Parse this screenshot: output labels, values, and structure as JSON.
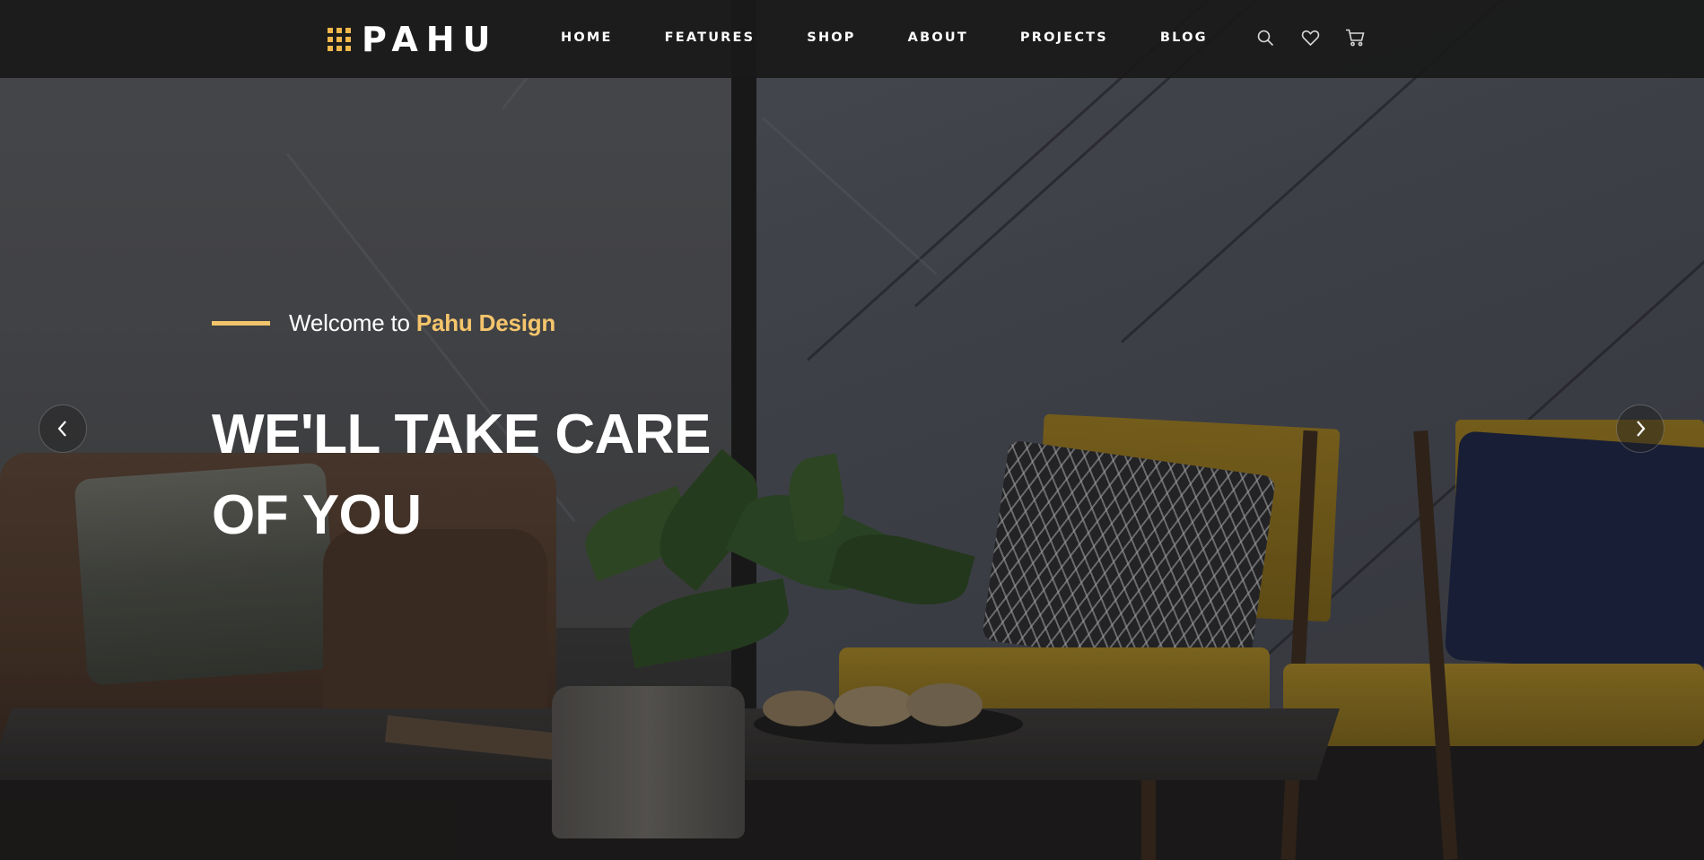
{
  "brand": {
    "logo_text": "PAHU",
    "accent_color": "#f2b84b"
  },
  "nav": {
    "items": [
      {
        "label": "HOME"
      },
      {
        "label": "FEATURES"
      },
      {
        "label": "SHOP"
      },
      {
        "label": "ABOUT"
      },
      {
        "label": "PROJECTS"
      },
      {
        "label": "BLOG"
      }
    ],
    "icons": [
      "search-icon",
      "heart-icon",
      "cart-icon"
    ]
  },
  "hero": {
    "welcome_prefix": "Welcome to ",
    "welcome_brand": "Pahu Design",
    "headline_line1": "WE'LL TAKE CARE",
    "headline_line2": "OF YOU",
    "prev_icon": "chevron-left-icon",
    "next_icon": "chevron-right-icon"
  }
}
